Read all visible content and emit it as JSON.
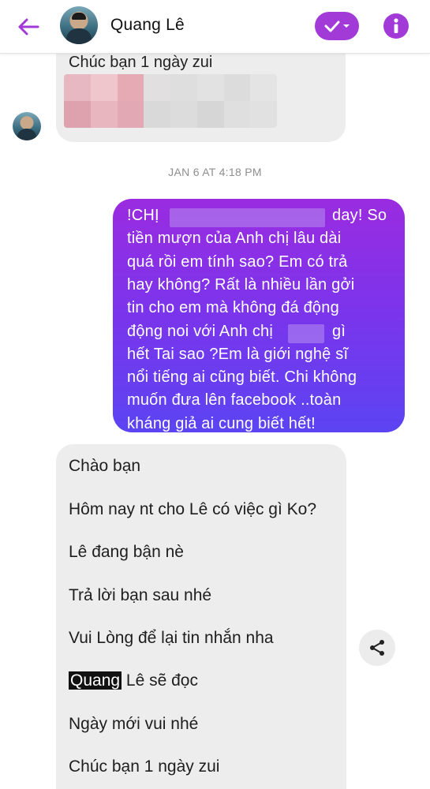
{
  "header": {
    "contact_name": "Quang Lê",
    "accent_color": "#a23ad8",
    "icons": [
      "back-arrow-icon",
      "check-dropdown-icon",
      "info-icon"
    ]
  },
  "messages": {
    "top_incoming": {
      "text": "Chúc bạn 1 ngày zui"
    },
    "timestamp": "JAN 6 AT 4:18 PM",
    "outgoing": {
      "lines": [
        "!CHỊ",
        "day! So",
        "tiền  mượn  của  Anh chị lâu dài",
        "quá  rồi  em tính sao? Em có trả",
        "hay không? Rất  là nhiều lần  gởi",
        "tin cho  em  mà không đá  động",
        "động  noi với  Anh chị",
        "gì",
        "hết  Tai sao  ?Em là  giới nghệ sĩ",
        "nổi tiếng  ai cũng biết. Chi không",
        "muốn  đưa lên facebook ..toàn",
        "kháng giả  ai cung biết  hết!"
      ],
      "gradient": [
        "#9a2be0",
        "#5b44f2"
      ]
    },
    "auto_reply": {
      "lines": [
        "Chào bạn",
        "Hôm nay nt cho Lê có việc gì Ko?",
        "Lê đang bận nè",
        "Trả lời bạn sau nhé",
        "Vui Lòng để lại tin nhắn nha",
        "Lê sẽ đọc",
        "Ngày mới vui nhé",
        "Chúc bạn 1 ngày zui"
      ],
      "highlighted_word": "Quang"
    }
  },
  "share_button": {
    "icon": "share-icon"
  }
}
